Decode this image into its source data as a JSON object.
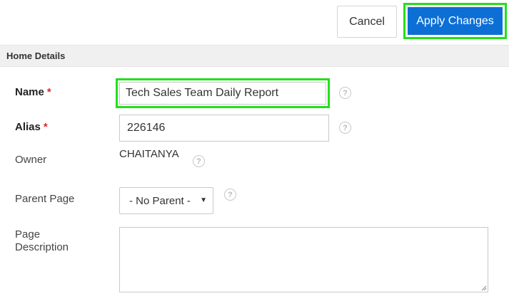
{
  "toolbar": {
    "cancel_label": "Cancel",
    "apply_label": "Apply Changes"
  },
  "section": {
    "title": "Home Details"
  },
  "form": {
    "name": {
      "label": "Name",
      "required_mark": "*",
      "value": "Tech Sales Team Daily Report"
    },
    "alias": {
      "label": "Alias",
      "required_mark": "*",
      "value": "226146"
    },
    "owner": {
      "label": "Owner",
      "value": "CHAITANYA"
    },
    "parent_page": {
      "label": "Parent Page",
      "selected": "- No Parent -"
    },
    "page_description": {
      "label_line1": "Page",
      "label_line2": "Description",
      "value": ""
    }
  },
  "icons": {
    "help": "help-icon",
    "dropdown": "chevron-down-icon"
  },
  "colors": {
    "primary_button": "#0c6fd6",
    "highlight": "#22e01a",
    "required": "#e0262b"
  }
}
